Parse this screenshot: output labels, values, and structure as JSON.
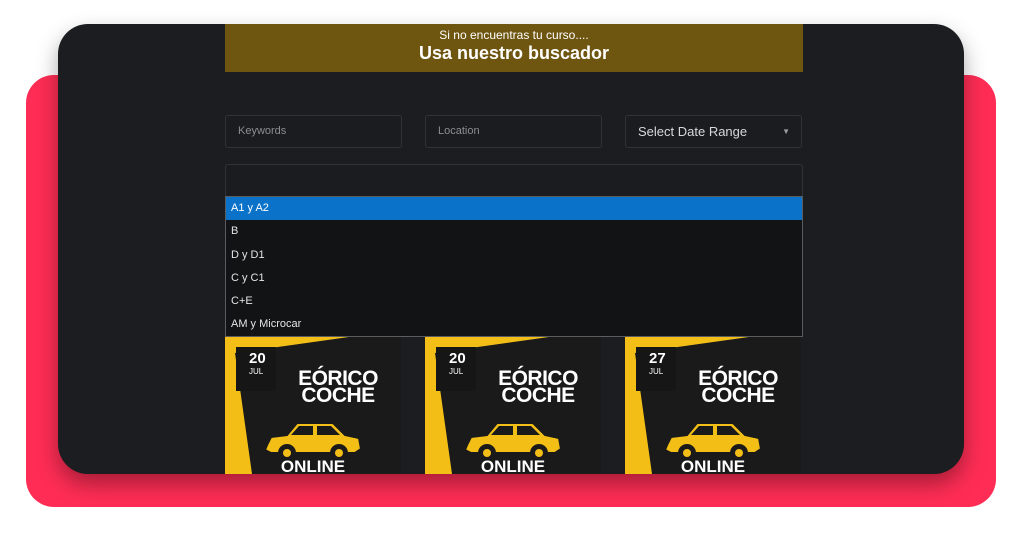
{
  "banner": {
    "subtitle": "Si no encuentras tu curso....",
    "title": "Usa nuestro buscador"
  },
  "search": {
    "keywords_placeholder": "Keywords",
    "location_placeholder": "Location",
    "date_range_label": "Select Date Range"
  },
  "category_dropdown": {
    "options": [
      "A1 y A2",
      "B",
      "D y D1",
      "C y C1",
      "C+E",
      "AM y Microcar"
    ],
    "highlighted_index": 0
  },
  "courses": [
    {
      "day": "20",
      "month": "JUL",
      "title_line1": "EÓRICO",
      "title_line2": "COCHE",
      "mode": "ONLINE"
    },
    {
      "day": "20",
      "month": "JUL",
      "title_line1": "EÓRICO",
      "title_line2": "COCHE",
      "mode": "ONLINE"
    },
    {
      "day": "27",
      "month": "JUL",
      "title_line1": "EÓRICO",
      "title_line2": "COCHE",
      "mode": "ONLINE"
    }
  ],
  "colors": {
    "accent_red": "#ff2d55",
    "banner_gold": "#6e5510",
    "card_yellow": "#f3bf17",
    "highlight_blue": "#0a72c8"
  }
}
